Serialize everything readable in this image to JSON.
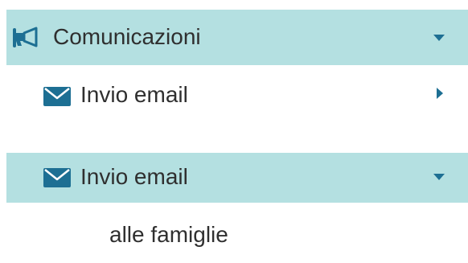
{
  "colors": {
    "highlight_bg": "#b4e0e1",
    "icon_color": "#1d6f93",
    "text_color": "#2f2f2f"
  },
  "menu1": {
    "header": {
      "icon": "megaphone-icon",
      "label": "Comunicazioni",
      "state": "expanded",
      "caret_icon": "caret-down-icon"
    },
    "item": {
      "icon": "envelope-icon",
      "label": "Invio email",
      "state": "collapsed",
      "caret_icon": "caret-right-icon"
    }
  },
  "menu2": {
    "header": {
      "icon": "envelope-icon",
      "label": "Invio email",
      "state": "expanded",
      "caret_icon": "caret-down-icon"
    },
    "subitems": [
      {
        "label": "alle famiglie"
      }
    ]
  }
}
